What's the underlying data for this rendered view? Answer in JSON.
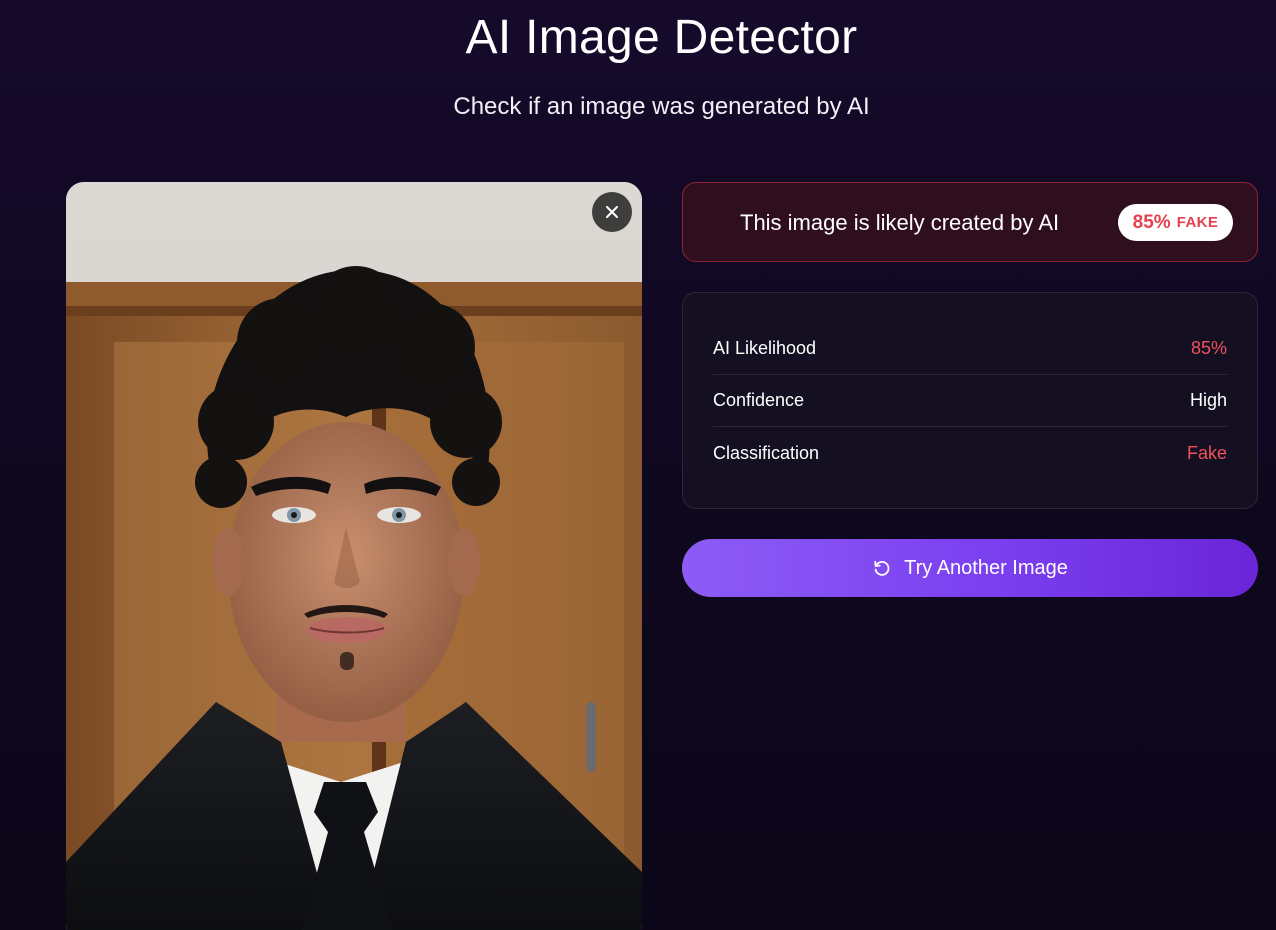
{
  "header": {
    "title": "AI Image Detector",
    "subtitle": "Check if an image was generated by AI"
  },
  "image_panel": {
    "close_icon": "close-icon"
  },
  "result": {
    "message": "This image is likely created by AI",
    "badge_percent": "85%",
    "badge_label": "FAKE",
    "accent_color": "#e5414f"
  },
  "stats": [
    {
      "label": "AI Likelihood",
      "value": "85%"
    },
    {
      "label": "Confidence",
      "value": "High"
    },
    {
      "label": "Classification",
      "value": "Fake"
    }
  ],
  "actions": {
    "try_another_label": "Try Another Image",
    "try_another_icon": "refresh-icon",
    "button_color": "#7a3ff0"
  }
}
